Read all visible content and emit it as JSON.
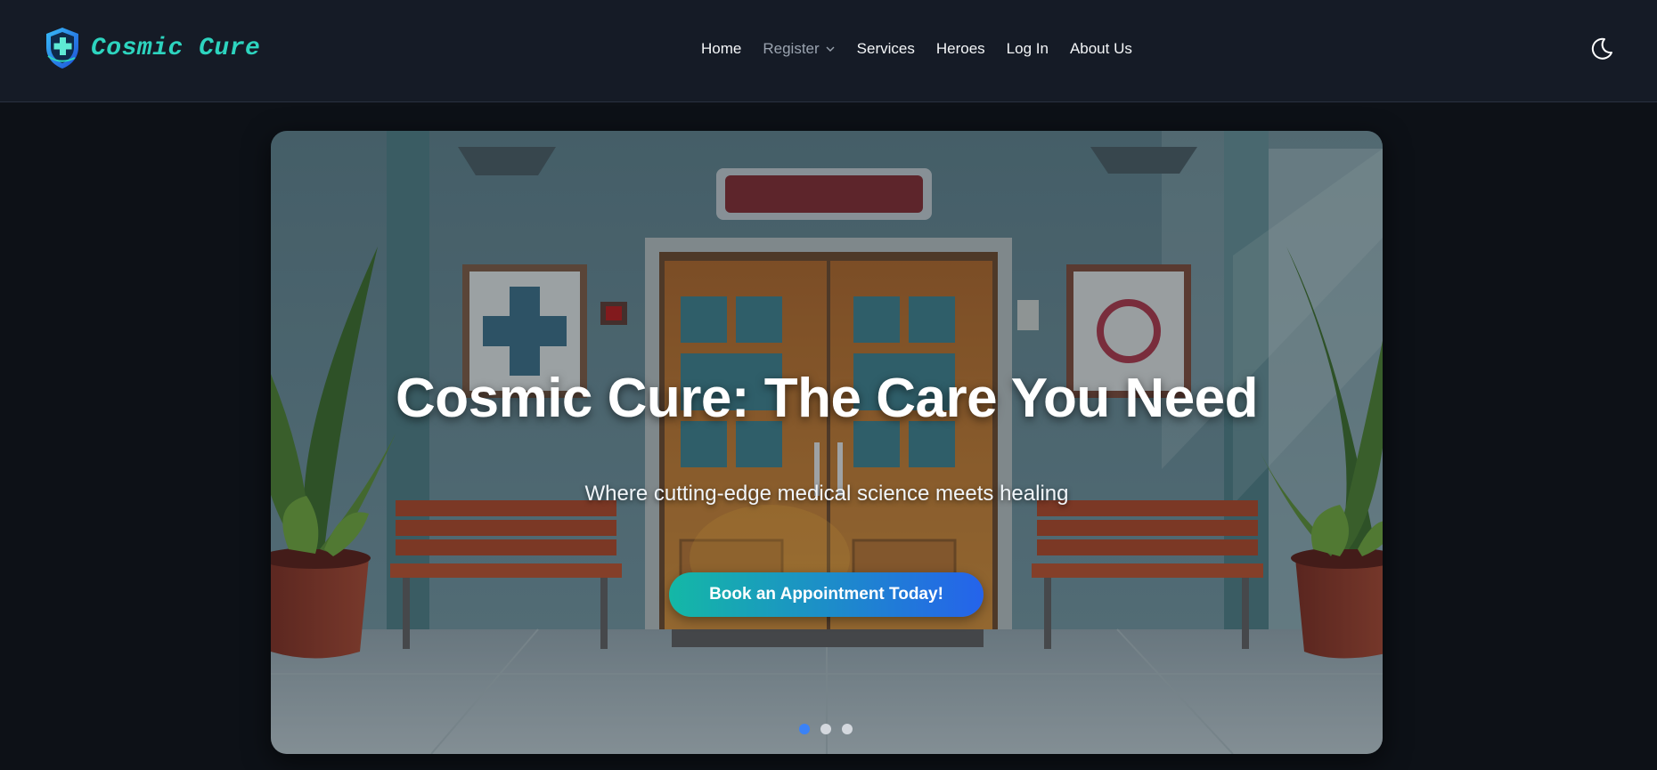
{
  "brand": {
    "name": "Cosmic Cure",
    "logo_icon": "shield-cross-icon"
  },
  "nav": {
    "items": [
      {
        "label": "Home"
      },
      {
        "label": "Register",
        "has_dropdown": true
      },
      {
        "label": "Services"
      },
      {
        "label": "Heroes"
      },
      {
        "label": "Log In"
      },
      {
        "label": "About Us"
      }
    ],
    "theme_toggle_icon": "moon-icon"
  },
  "hero": {
    "title": "Cosmic Cure: The Care You Need",
    "subtitle": "Where cutting-edge medical science meets healing",
    "cta_label": "Book an Appointment Today!",
    "slide_count": 3,
    "active_slide": 1
  },
  "colors": {
    "page_bg": "#0d1117",
    "navbar_bg": "#151b26",
    "brand_accent": "#2dd4bf",
    "cta_gradient_start": "#14b8a6",
    "cta_gradient_end": "#2563eb",
    "dot_active": "#3b82f6"
  }
}
